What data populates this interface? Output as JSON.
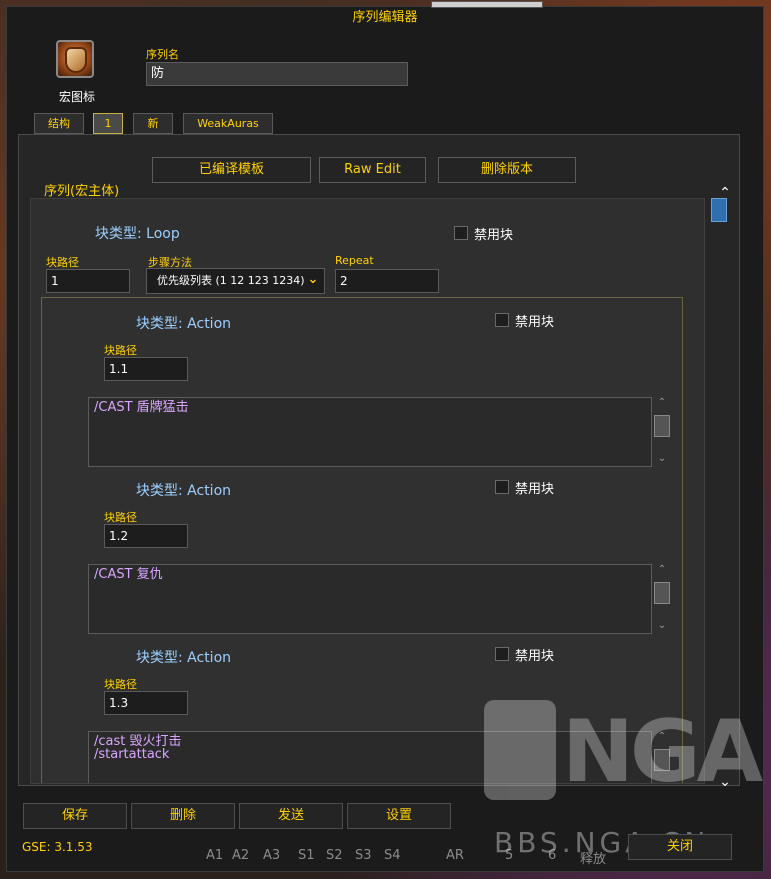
{
  "window": {
    "title": "序列编辑器"
  },
  "macro_icon": {
    "label": "宏图标"
  },
  "sequence_name": {
    "label": "序列名",
    "value": "防"
  },
  "tabs": [
    {
      "label": "结构",
      "active": false
    },
    {
      "label": "1",
      "active": true
    },
    {
      "label": "新",
      "active": false
    },
    {
      "label": "WeakAuras",
      "active": false
    }
  ],
  "toolbar": {
    "compiled_template": "已编译模板",
    "raw_edit": "Raw Edit",
    "delete_version": "删除版本"
  },
  "sequence_body_label": "序列(宏主体)",
  "loop_block": {
    "type_label": "块类型: Loop",
    "disable_label": "禁用块",
    "path_label": "块路径",
    "path_value": "1",
    "step_label": "步骤方法",
    "step_value": "优先级列表 (1 12 123 1234)",
    "repeat_label": "Repeat",
    "repeat_value": "2"
  },
  "action_blocks": [
    {
      "type_label": "块类型: Action",
      "disable_label": "禁用块",
      "path_label": "块路径",
      "path_value": "1.1",
      "macro_text": "/CAST 盾牌猛击"
    },
    {
      "type_label": "块类型: Action",
      "disable_label": "禁用块",
      "path_label": "块路径",
      "path_value": "1.2",
      "macro_text": "/CAST 复仇"
    },
    {
      "type_label": "块类型: Action",
      "disable_label": "禁用块",
      "path_label": "块路径",
      "path_value": "1.3",
      "macro_text_line1": "/cast 毁火打击",
      "macro_text_line2": "/startattack"
    }
  ],
  "bottom_buttons": {
    "save": "保存",
    "delete": "删除",
    "send": "发送",
    "settings": "设置",
    "close": "关闭"
  },
  "version": "GSE: 3.1.53",
  "watermark": {
    "logo_text": "NGA",
    "url": "BBS.NGA.CN"
  },
  "action_bar": [
    "A1",
    "A2",
    "A3",
    "S1",
    "S2",
    "S3",
    "S4",
    "AR",
    "5",
    "6",
    "释放"
  ],
  "colors": {
    "gold": "#ffd100",
    "block_type": "#9ccfff",
    "macro_text": "#d9a6ff",
    "scroll_thumb": "#2f6fb0"
  }
}
